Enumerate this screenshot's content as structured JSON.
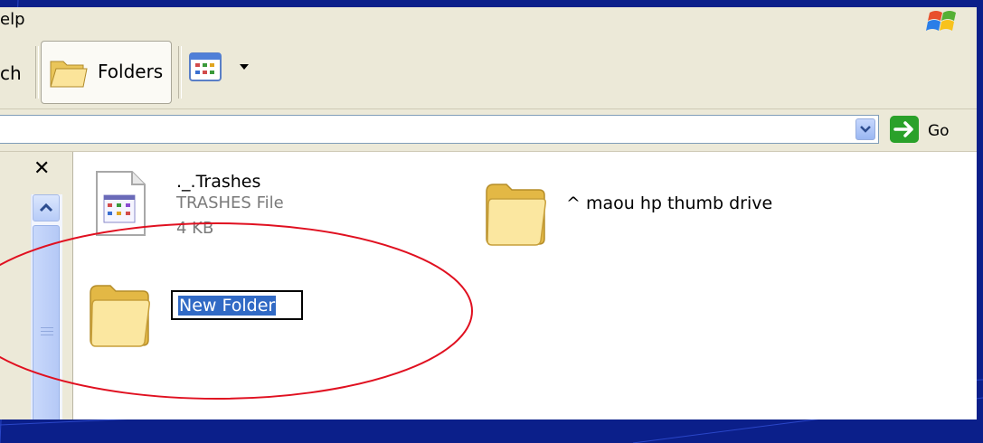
{
  "menubar": {
    "partial_item": "elp"
  },
  "toolbar": {
    "partial_search_label": "ch",
    "folders_label": "Folders"
  },
  "addressbar": {
    "go_label": "Go"
  },
  "leftpane": {
    "close_glyph": "✕"
  },
  "files": [
    {
      "name": "._.Trashes",
      "type": "TRASHES File",
      "size": "4 KB",
      "icon": "generic-file-icon"
    },
    {
      "name": "^ maou hp thumb drive",
      "icon": "folder-icon"
    },
    {
      "name": "New Folder",
      "icon": "folder-icon",
      "state": "renaming"
    }
  ],
  "colors": {
    "desktop_bg": "#0b1f8a",
    "chrome_bg": "#ece9d8",
    "selection": "#316ac5",
    "annotation": "#e01020",
    "go_green": "#2aa12a"
  }
}
